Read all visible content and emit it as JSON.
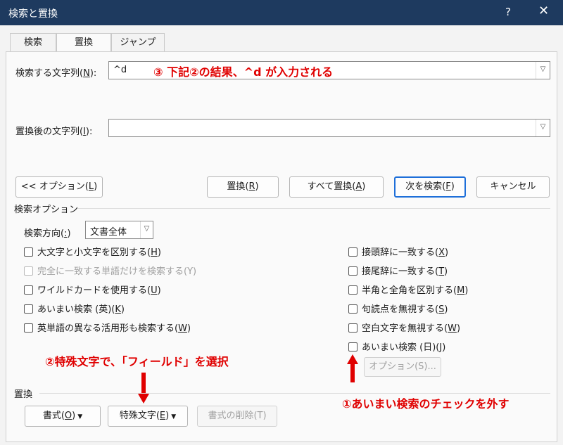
{
  "window": {
    "title": "検索と置換",
    "help_label": "?",
    "close_label": "✕"
  },
  "tabs": [
    {
      "label": "検索"
    },
    {
      "label": "置換"
    },
    {
      "label": "ジャンプ"
    }
  ],
  "find": {
    "label_pre": "検索する文字列(",
    "label_key": "N",
    "label_post": "):",
    "value": "^d"
  },
  "replace": {
    "label_pre": "置換後の文字列(",
    "label_key": "I",
    "label_post": "):",
    "value": ""
  },
  "buttons": {
    "options": {
      "pre": "<< オプション(",
      "key": "L",
      "post": ")"
    },
    "replace": {
      "pre": "置換(",
      "key": "R",
      "post": ")"
    },
    "replace_all": {
      "pre": "すべて置換(",
      "key": "A",
      "post": ")"
    },
    "find_next": {
      "pre": "次を検索(",
      "key": "F",
      "post": ")"
    },
    "cancel": "キャンセル"
  },
  "search_options": {
    "title": "検索オプション",
    "direction": {
      "label_pre": "検索方向(",
      "label_key": ":",
      "label_post": ")",
      "value": "文書全体"
    },
    "left": [
      {
        "pre": "大文字と小文字を区別する(",
        "key": "H",
        "post": ")",
        "checked": false,
        "disabled": false
      },
      {
        "pre": "完全に一致する単語だけを検索する(",
        "key": "Y",
        "post": ")",
        "checked": false,
        "disabled": true
      },
      {
        "pre": "ワイルドカードを使用する(",
        "key": "U",
        "post": ")",
        "checked": false,
        "disabled": false
      },
      {
        "pre": "あいまい検索 (英)(",
        "key": "K",
        "post": ")",
        "checked": false,
        "disabled": false
      },
      {
        "pre": "英単語の異なる活用形も検索する(",
        "key": "W",
        "post": ")",
        "checked": false,
        "disabled": false
      }
    ],
    "right": [
      {
        "pre": "接頭辞に一致する(",
        "key": "X",
        "post": ")",
        "checked": false
      },
      {
        "pre": "接尾辞に一致する(",
        "key": "T",
        "post": ")",
        "checked": false
      },
      {
        "pre": "半角と全角を区別する(",
        "key": "M",
        "post": ")",
        "checked": false
      },
      {
        "pre": "句読点を無視する(",
        "key": "S",
        "post": ")",
        "checked": false
      },
      {
        "pre": "空白文字を無視する(",
        "key": "W",
        "post": ")",
        "checked": false
      },
      {
        "pre": "あいまい検索 (日)(",
        "key": "J",
        "post": ")",
        "checked": false
      }
    ],
    "fuzzy_options_button": "オプション(S)..."
  },
  "replace_group": {
    "title": "置換",
    "format": {
      "pre": "書式(",
      "key": "O",
      "post": ")"
    },
    "special": {
      "pre": "特殊文字(",
      "key": "E",
      "post": ")"
    },
    "clear_format": "書式の削除(T)"
  },
  "annotations": {
    "a3": "③  下記②の結果、^d が入力される",
    "a2": "②特殊文字で、「フィールド」を選択",
    "a1": "①あいまい検索のチェックを外す"
  },
  "colors": {
    "titlebar": "#1e3a5f",
    "annotation": "#e00000",
    "primary_border": "#1e6fd9"
  }
}
